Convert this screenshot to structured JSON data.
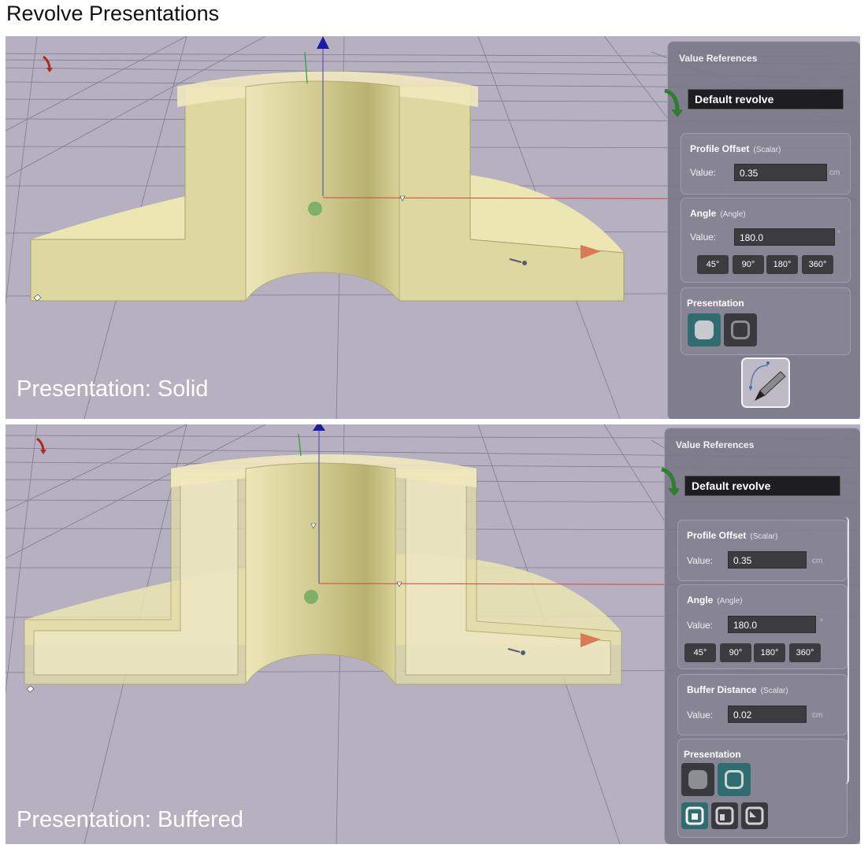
{
  "page": {
    "title": "Revolve Presentations"
  },
  "solid": {
    "caption": "Presentation: Solid",
    "panel_title": "Value References",
    "revolve_name": "Default revolve",
    "profile_offset": {
      "title": "Profile Offset",
      "type": "(Scalar)",
      "value_label": "Value:",
      "value": "0.35",
      "unit": "cm"
    },
    "angle": {
      "title": "Angle",
      "type": "(Angle)",
      "value_label": "Value:",
      "value": "180.0",
      "unit": "°",
      "presets": [
        "45°",
        "90°",
        "180°",
        "360°"
      ]
    },
    "presentation": {
      "title": "Presentation",
      "options": [
        "solid-icon",
        "buffered-icon"
      ],
      "selected": "solid-icon"
    },
    "edit_button": "curve-pencil-icon"
  },
  "buffered": {
    "caption": "Presentation: Buffered",
    "panel_title": "Value References",
    "revolve_name": "Default revolve",
    "profile_offset": {
      "title": "Profile Offset",
      "type": "(Scalar)",
      "value_label": "Value:",
      "value": "0.35",
      "unit": "cm"
    },
    "angle": {
      "title": "Angle",
      "type": "(Angle)",
      "value_label": "Value:",
      "value": "180.0",
      "unit": "°",
      "presets": [
        "45°",
        "90°",
        "180°",
        "360°"
      ]
    },
    "buffer_distance": {
      "title": "Buffer Distance",
      "type": "(Scalar)",
      "value_label": "Value:",
      "value": "0.02",
      "unit": "cm"
    },
    "presentation": {
      "title": "Presentation",
      "options": [
        "solid-icon",
        "buffered-icon"
      ],
      "selected": "buffered-icon",
      "sides": [
        "side-front-icon",
        "side-back-icon",
        "side-both-icon"
      ],
      "selected_side": "side-front-icon"
    }
  },
  "colors": {
    "viewport": "#b6b0c1",
    "model": "#e6e0a6",
    "accent_selected": "#2f6d70",
    "axis_x": "#d2463c",
    "axis_y": "#2aa02a",
    "axis_z": "#1a1aa8"
  }
}
